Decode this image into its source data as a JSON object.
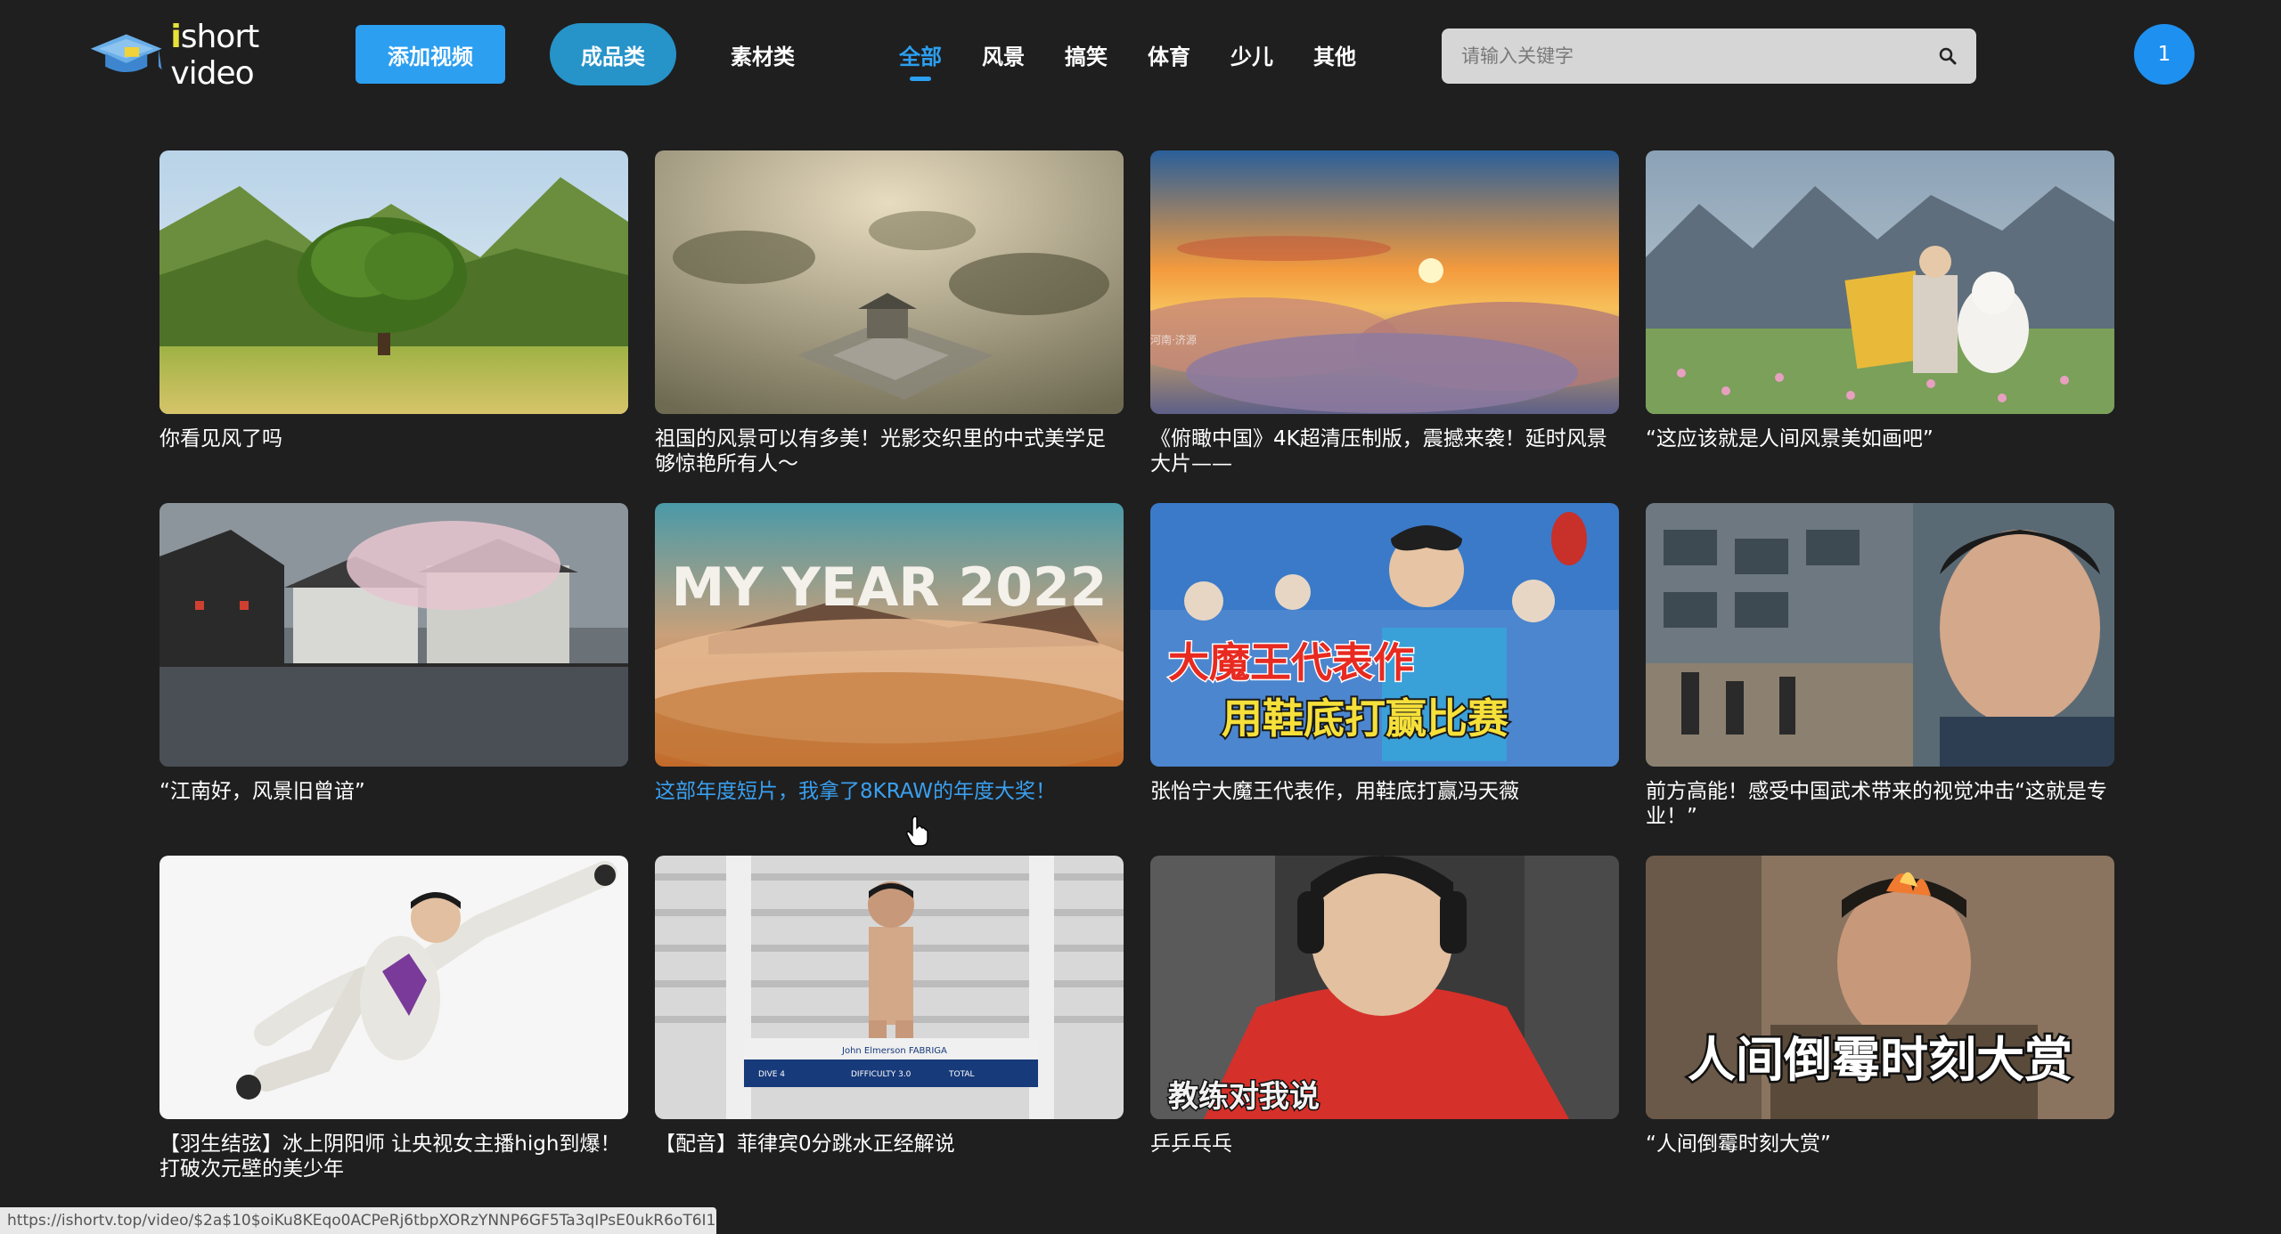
{
  "header": {
    "logo_text": "short video",
    "add_video": "添加视频",
    "finished": "成品类",
    "material": "素材类",
    "tabs": [
      "全部",
      "风景",
      "搞笑",
      "体育",
      "少儿",
      "其他"
    ],
    "active_tab": "全部",
    "search_placeholder": "请输入关键字",
    "avatar_label": "1",
    "accent_color": "#2c9ff0"
  },
  "videos": [
    {
      "title": "你看见风了吗"
    },
    {
      "title": "祖国的风景可以有多美！光影交织里的中式美学足够惊艳所有人～"
    },
    {
      "title": "《俯瞰中国》4K超清压制版，震撼来袭！延时风景大片——"
    },
    {
      "title": "“这应该就是人间风景美如画吧”"
    },
    {
      "title": "“江南好，风景旧曾谙”"
    },
    {
      "title": "这部年度短片，我拿了8KRAW的年度大奖！",
      "overlay": "MY YEAR 2022"
    },
    {
      "title": "张怡宁大魔王代表作，用鞋底打赢冯天薇",
      "overlay_line1": "大魔王代表作",
      "overlay_line2": "用鞋底打赢比赛"
    },
    {
      "title": "前方高能！感受中国武术带来的视觉冲击“这就是专业！”"
    },
    {
      "title": "【羽生结弦】冰上阴阳师 让央视女主播high到爆！打破次元壁的美少年"
    },
    {
      "title": "【配音】菲律宾0分跳水正经解说",
      "overlay": "John Elmerson FABRIGA",
      "overlay_sub1": "DIVE 4",
      "overlay_sub2": "DIFFICULTY 3.0",
      "overlay_sub3": "TOTAL"
    },
    {
      "title": "乒乒乓乓",
      "overlay": "教练对我说"
    },
    {
      "title": "“人间倒霉时刻大赏”",
      "overlay": "人间倒霉时刻大赏"
    }
  ],
  "watermark_4k": "河南·济源",
  "status_url": "https://ishortv.top/video/$2a$10$oiKu8KEqo0ACPeRj6tbpXORzYNNP6GF5Ta3qIPsE0ukR6oT6I1g8a"
}
